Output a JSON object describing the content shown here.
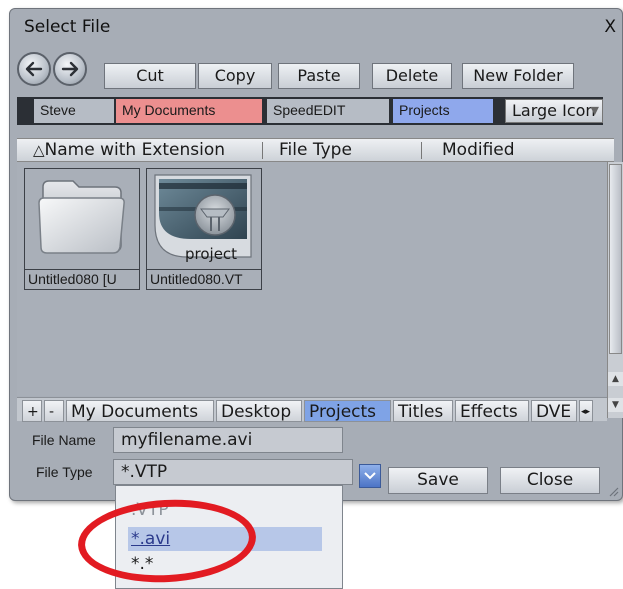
{
  "dialog": {
    "title": "Select File",
    "close_label": "X"
  },
  "toolbar": {
    "buttons": [
      {
        "label": "Cut"
      },
      {
        "label": "Copy"
      },
      {
        "label": "Paste"
      },
      {
        "label": "Delete"
      },
      {
        "label": "New Folder"
      }
    ]
  },
  "locations": {
    "tabs": [
      {
        "label": "Steve",
        "color": "#b6bcc5"
      },
      {
        "label": "My Documents",
        "color": "#ec8f8f"
      },
      {
        "label": "SpeedEDIT",
        "color": "#b6bcc5"
      },
      {
        "label": "Projects",
        "color": "#8fa8ec"
      }
    ],
    "view_mode": "Large Icon"
  },
  "columns": {
    "name": "Name with Extension",
    "type": "File Type",
    "modified": "Modified"
  },
  "files": [
    {
      "label": "Untitled080 [U",
      "icon": "folder-icon"
    },
    {
      "label": "Untitled080.VT",
      "icon": "project-icon",
      "badge": "project"
    }
  ],
  "bottom_tabs": {
    "add": "+",
    "remove": "-",
    "tabs": [
      {
        "label": "My Documents"
      },
      {
        "label": "Desktop"
      },
      {
        "label": "Projects"
      },
      {
        "label": "Titles"
      },
      {
        "label": "Effects"
      },
      {
        "label": "DVE"
      }
    ]
  },
  "form": {
    "file_name_label": "File Name",
    "file_name_value": "myfilename.avi",
    "file_type_label": "File Type",
    "file_type_value": "*.VTP",
    "save_label": "Save",
    "close_label": "Close"
  },
  "file_type_options": [
    {
      "label": ".VTP"
    },
    {
      "label": "*.avi"
    },
    {
      "label": "*.*"
    }
  ]
}
